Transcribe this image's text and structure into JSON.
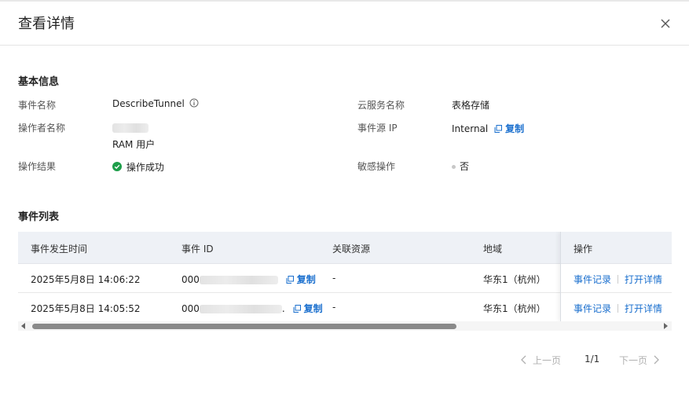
{
  "dialog": {
    "title": "查看详情"
  },
  "basic": {
    "section_title": "基本信息",
    "event_name_label": "事件名称",
    "event_name_value": "DescribeTunnel",
    "operator_label": "操作者名称",
    "operator_type": "RAM 用户",
    "result_label": "操作结果",
    "result_value": "操作成功",
    "service_label": "云服务名称",
    "service_value": "表格存储",
    "source_ip_label": "事件源 IP",
    "source_ip_value": "Internal",
    "copy_label": "复制",
    "sensitive_label": "敏感操作",
    "sensitive_value": "否"
  },
  "events": {
    "section_title": "事件列表",
    "columns": [
      "事件发生时间",
      "事件 ID",
      "关联资源",
      "地域",
      "操作"
    ],
    "rows": [
      {
        "time": "2025年5月8日 14:06:22",
        "id_prefix": "000",
        "id_suffix": "",
        "copy": "复制",
        "resource": "-",
        "region": "华东1（杭州）",
        "action1": "事件记录",
        "action2": "打开详情"
      },
      {
        "time": "2025年5月8日 14:05:52",
        "id_prefix": "000",
        "id_suffix": ".",
        "copy": "复制",
        "resource": "-",
        "region": "华东1（杭州）",
        "action1": "事件记录",
        "action2": "打开详情"
      }
    ]
  },
  "pagination": {
    "prev": "上一页",
    "page": "1/1",
    "next": "下一页"
  },
  "colors": {
    "link": "#1a6fce",
    "success": "#1e9e4a",
    "header_bg": "#eef1f6"
  },
  "icons": [
    "close-icon",
    "info-icon",
    "copy-icon",
    "check-circle-icon",
    "chevron-left-icon",
    "chevron-right-icon"
  ]
}
